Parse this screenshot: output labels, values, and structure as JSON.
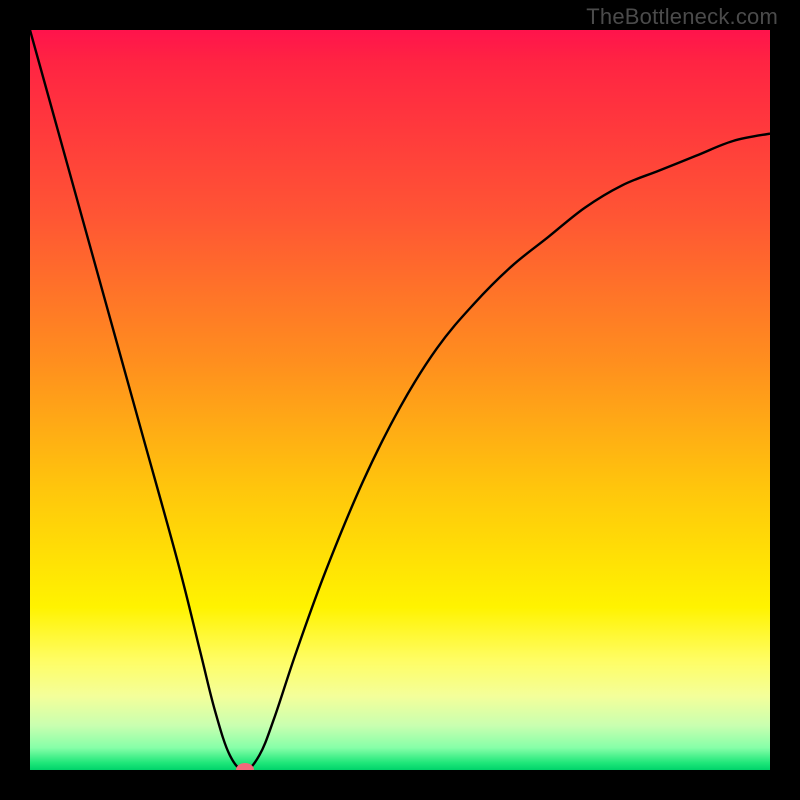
{
  "watermark": "TheBottleneck.com",
  "chart_data": {
    "type": "line",
    "title": "",
    "xlabel": "",
    "ylabel": "",
    "xlim": [
      0,
      100
    ],
    "ylim": [
      0,
      100
    ],
    "grid": false,
    "legend": false,
    "series": [
      {
        "name": "bottleneck-curve",
        "x": [
          0,
          5,
          10,
          15,
          20,
          23,
          25,
          27,
          29,
          31,
          33,
          36,
          40,
          45,
          50,
          55,
          60,
          65,
          70,
          75,
          80,
          85,
          90,
          95,
          100
        ],
        "y": [
          100,
          82,
          64,
          46,
          28,
          16,
          8,
          2,
          0,
          2,
          7,
          16,
          27,
          39,
          49,
          57,
          63,
          68,
          72,
          76,
          79,
          81,
          83,
          85,
          86
        ]
      }
    ],
    "annotations": [
      {
        "name": "bottleneck-marker",
        "x": 29,
        "y": 0
      }
    ],
    "gradient_stops": [
      {
        "pos": 0,
        "color": "#ff134c"
      },
      {
        "pos": 25,
        "color": "#ff5534"
      },
      {
        "pos": 45,
        "color": "#ff8f1e"
      },
      {
        "pos": 62,
        "color": "#ffc60c"
      },
      {
        "pos": 78,
        "color": "#fff300"
      },
      {
        "pos": 90,
        "color": "#f4ff9a"
      },
      {
        "pos": 100,
        "color": "#00d36a"
      }
    ]
  }
}
